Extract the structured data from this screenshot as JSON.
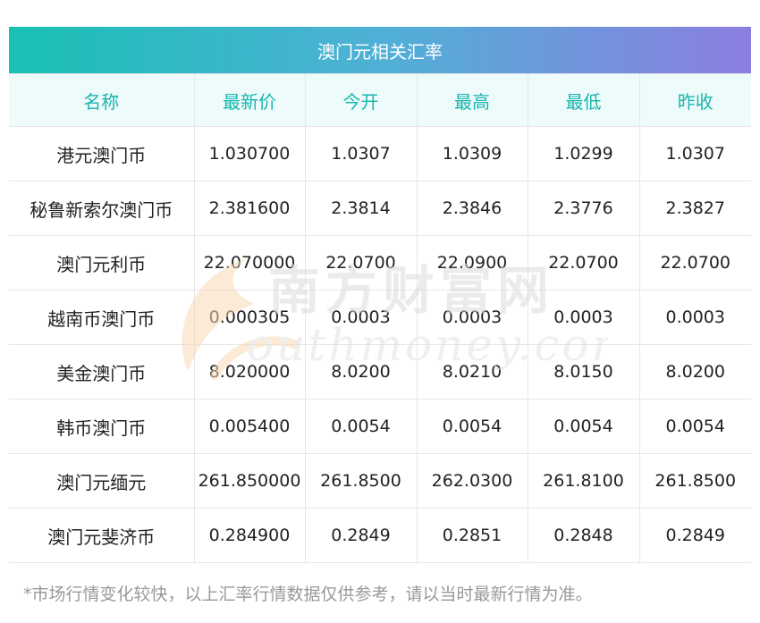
{
  "title": "澳门元相关汇率",
  "columns": [
    "名称",
    "最新价",
    "今开",
    "最高",
    "最低",
    "昨收"
  ],
  "rows": [
    [
      "港元澳门币",
      "1.030700",
      "1.0307",
      "1.0309",
      "1.0299",
      "1.0307"
    ],
    [
      "秘鲁新索尔澳门币",
      "2.381600",
      "2.3814",
      "2.3846",
      "2.3776",
      "2.3827"
    ],
    [
      "澳门元利币",
      "22.070000",
      "22.0700",
      "22.0900",
      "22.0700",
      "22.0700"
    ],
    [
      "越南币澳门币",
      "0.000305",
      "0.0003",
      "0.0003",
      "0.0003",
      "0.0003"
    ],
    [
      "美金澳门币",
      "8.020000",
      "8.0200",
      "8.0210",
      "8.0150",
      "8.0200"
    ],
    [
      "韩币澳门币",
      "0.005400",
      "0.0054",
      "0.0054",
      "0.0054",
      "0.0054"
    ],
    [
      "澳门元缅元",
      "261.850000",
      "261.8500",
      "262.0300",
      "261.8100",
      "261.8500"
    ],
    [
      "澳门元斐济币",
      "0.284900",
      "0.2849",
      "0.2851",
      "0.2848",
      "0.2849"
    ]
  ],
  "watermark": {
    "brand": "南方财富网",
    "domain": "outhmoney.com"
  },
  "footnote": "*市场行情变化较快，以上汇率行情数据仅供参考，请以当时最新行情为准。",
  "colors": {
    "header_gradient_start": "#19c0b4",
    "header_gradient_end": "#8c7ee0",
    "column_header_text": "#19b5ac",
    "column_header_bg": "#eefbfb",
    "note_text": "#999999"
  }
}
